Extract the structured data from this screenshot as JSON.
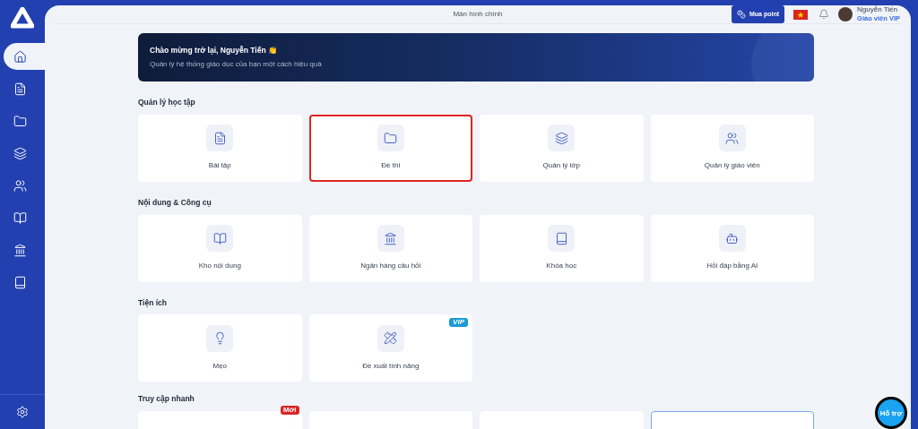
{
  "sidebar": {
    "items": [
      {
        "selected": true
      },
      {
        "selected": false
      },
      {
        "selected": false
      },
      {
        "selected": false
      },
      {
        "selected": false
      },
      {
        "selected": false
      },
      {
        "selected": false
      },
      {
        "selected": false
      }
    ]
  },
  "header": {
    "title": "Màn hình chính",
    "buy_button": "Mua point",
    "user": {
      "name": "Nguyễn Tiến",
      "role": "Giáo viên VIP"
    }
  },
  "banner": {
    "title": "Chào mừng trở lại, Nguyễn Tiến",
    "emoji": "👏",
    "subtitle": "Quản lý hệ thống giáo dục của bạn một cách hiệu quả"
  },
  "sections": [
    {
      "title": "Quản lý học tập",
      "cards": [
        {
          "label": "Bài tập",
          "highlighted": false
        },
        {
          "label": "Đề thi",
          "highlighted": true
        },
        {
          "label": "Quản lý lớp",
          "highlighted": false
        },
        {
          "label": "Quản lý giáo viên",
          "highlighted": false
        }
      ]
    },
    {
      "title": "Nội dung & Công cụ",
      "cards": [
        {
          "label": "Kho nội dung",
          "highlighted": false
        },
        {
          "label": "Ngân hàng câu hỏi",
          "highlighted": false
        },
        {
          "label": "Khóa học",
          "highlighted": false
        },
        {
          "label": "Hỏi đáp bằng AI",
          "highlighted": false
        }
      ]
    },
    {
      "title": "Tiện ích",
      "cards": [
        {
          "label": "Mẹo",
          "highlighted": false
        },
        {
          "label": "Đề xuất tính năng",
          "highlighted": false,
          "badge": "VIP"
        }
      ]
    }
  ],
  "quick_access": {
    "title": "Truy cập nhanh",
    "cards": [
      {
        "badge": "Mới",
        "active": false
      },
      {
        "active": false
      },
      {
        "active": false
      },
      {
        "active": true
      }
    ]
  },
  "support_button": "Hỗ trợ"
}
